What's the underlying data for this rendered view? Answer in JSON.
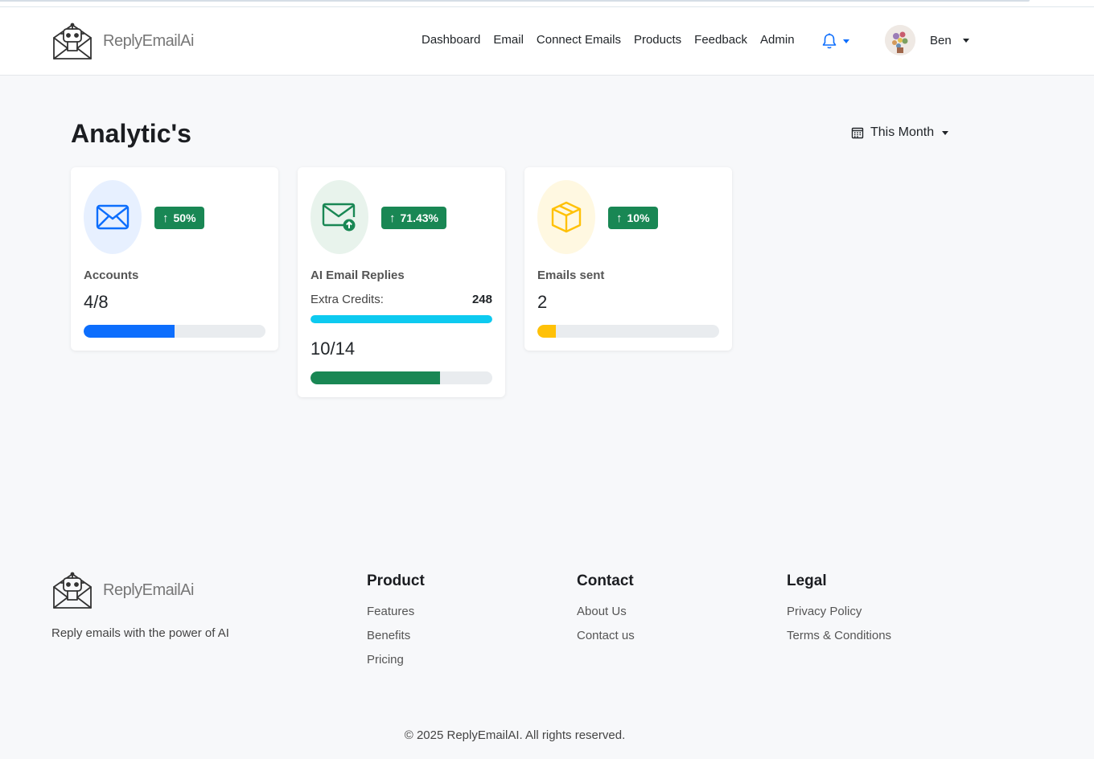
{
  "brand": {
    "name": "ReplyEmailAi"
  },
  "nav": {
    "links": [
      "Dashboard",
      "Email",
      "Connect Emails",
      "Products",
      "Feedback",
      "Admin"
    ],
    "notification_icon": "bell-icon",
    "user": {
      "name": "Ben"
    }
  },
  "page": {
    "title": "Analytic's",
    "period": "This Month"
  },
  "cards": [
    {
      "icon": "envelope-icon",
      "change": "50%",
      "label": "Accounts",
      "value": "4/8",
      "progress": 0.5,
      "color": "#0d6efd"
    },
    {
      "icon": "envelope-arrow-up-icon",
      "change": "71.43%",
      "label": "AI Email Replies",
      "extra_label": "Extra Credits:",
      "extra_value": "248",
      "extra_progress": 1.0,
      "extra_color": "#0dcaf0",
      "value": "10/14",
      "progress": 0.7143,
      "color": "#198754"
    },
    {
      "icon": "box-icon",
      "change": "10%",
      "label": "Emails sent",
      "value": "2",
      "progress": 0.1,
      "color": "#ffc107"
    }
  ],
  "footer": {
    "tagline": "Reply emails with the power of AI",
    "columns": [
      {
        "title": "Product",
        "links": [
          "Features",
          "Benefits",
          "Pricing"
        ]
      },
      {
        "title": "Contact",
        "links": [
          "About Us",
          "Contact us"
        ]
      },
      {
        "title": "Legal",
        "links": [
          "Privacy Policy",
          "Terms & Conditions"
        ]
      }
    ],
    "copyright": "© 2025 ReplyEmailAI. All rights reserved."
  }
}
